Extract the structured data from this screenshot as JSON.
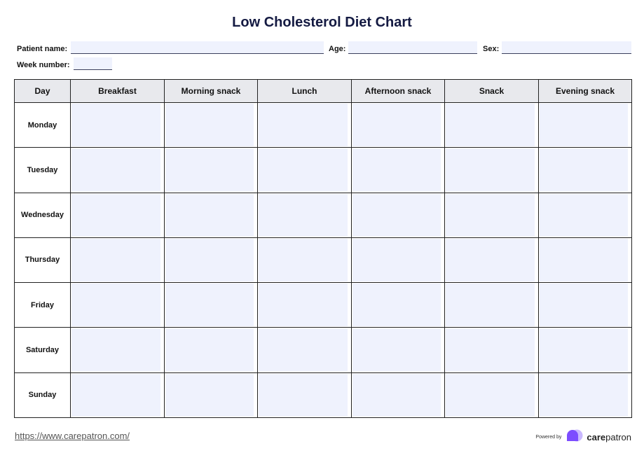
{
  "document": {
    "title": "Low Cholesterol Diet Chart"
  },
  "fields": {
    "patient_name": {
      "label": "Patient name:",
      "value": ""
    },
    "age": {
      "label": "Age:",
      "value": ""
    },
    "sex": {
      "label": "Sex:",
      "value": ""
    },
    "week_number": {
      "label": "Week number:",
      "value": ""
    }
  },
  "table": {
    "headers": [
      "Day",
      "Breakfast",
      "Morning snack",
      "Lunch",
      "Afternoon snack",
      "Snack",
      "Evening snack"
    ],
    "rows": [
      {
        "day": "Monday",
        "cells": [
          "",
          "",
          "",
          "",
          "",
          ""
        ]
      },
      {
        "day": "Tuesday",
        "cells": [
          "",
          "",
          "",
          "",
          "",
          ""
        ]
      },
      {
        "day": "Wednesday",
        "cells": [
          "",
          "",
          "",
          "",
          "",
          ""
        ]
      },
      {
        "day": "Thursday",
        "cells": [
          "",
          "",
          "",
          "",
          "",
          ""
        ]
      },
      {
        "day": "Friday",
        "cells": [
          "",
          "",
          "",
          "",
          "",
          ""
        ]
      },
      {
        "day": "Saturday",
        "cells": [
          "",
          "",
          "",
          "",
          "",
          ""
        ]
      },
      {
        "day": "Sunday",
        "cells": [
          "",
          "",
          "",
          "",
          "",
          ""
        ]
      }
    ]
  },
  "footer": {
    "link": "https://www.carepatron.com/",
    "powered_by": "Powered by",
    "brand_bold": "care",
    "brand_light": "patron",
    "logo_colors": {
      "primary": "#7c4dff",
      "secondary": "#c9b8ff"
    }
  },
  "colors": {
    "title": "#141a42",
    "field_fill": "#eff2fd",
    "header_fill": "#e8e9ed"
  }
}
